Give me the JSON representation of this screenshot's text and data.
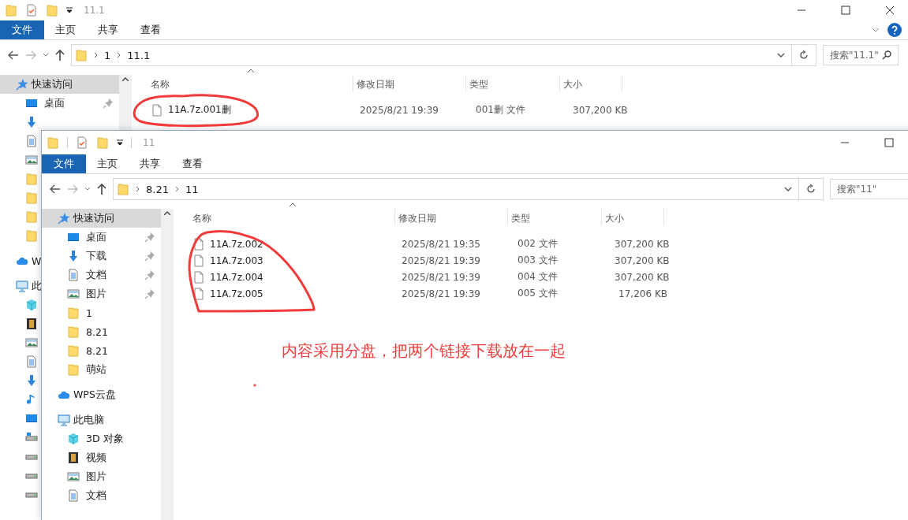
{
  "back_window": {
    "title": "11.1",
    "title_separators": false,
    "close_button": true,
    "help_button": true,
    "ribbon_tabs": [
      {
        "label": "文件",
        "kind": "file_menu"
      },
      {
        "label": "主页",
        "kind": "tab"
      },
      {
        "label": "共享",
        "kind": "tab"
      },
      {
        "label": "查看",
        "kind": "tab"
      }
    ],
    "path": [
      "1",
      "11.1"
    ],
    "search": {
      "placeholder": "搜索\"11.1\""
    },
    "sidebar": [
      {
        "label": "快速访问",
        "kind": "star",
        "selected": true,
        "children": [
          {
            "label": "桌面",
            "kind": "desktop",
            "pinned": true
          },
          {
            "kind": "download"
          },
          {
            "kind": "doc"
          },
          {
            "kind": "picture"
          },
          {
            "kind": "folder"
          },
          {
            "kind": "folder"
          },
          {
            "kind": "folder"
          },
          {
            "kind": "folder"
          }
        ]
      },
      {
        "label": "W",
        "kind": "cloud",
        "selected": false
      },
      {
        "label": "此",
        "kind": "pc",
        "selected": false,
        "children": [
          {
            "kind": "cube"
          },
          {
            "kind": "video"
          },
          {
            "kind": "picture"
          },
          {
            "kind": "doc"
          },
          {
            "kind": "download"
          },
          {
            "kind": "music"
          },
          {
            "kind": "desktop"
          },
          {
            "kind": "drive-win"
          },
          {
            "kind": "drive"
          },
          {
            "kind": "drive"
          },
          {
            "kind": "drive"
          }
        ]
      }
    ],
    "columns": [
      "名称",
      "修改日期",
      "类型",
      "大小"
    ],
    "files": [
      {
        "name": "11A.7z.001删",
        "modified": "2025/8/21 19:39",
        "type": "001删 文件",
        "size": "307,200 KB"
      }
    ]
  },
  "front_window": {
    "title": "11",
    "title_separators": true,
    "ribbon_tabs": [
      {
        "label": "文件",
        "kind": "file_menu"
      },
      {
        "label": "主页",
        "kind": "tab"
      },
      {
        "label": "共享",
        "kind": "tab"
      },
      {
        "label": "查看",
        "kind": "tab"
      }
    ],
    "path": [
      "8.21",
      "11"
    ],
    "search": {
      "placeholder": "搜索\"11\""
    },
    "sidebar": [
      {
        "label": "快速访问",
        "kind": "star",
        "selected": true,
        "children": [
          {
            "label": "桌面",
            "kind": "desktop",
            "pinned": true
          },
          {
            "label": "下载",
            "kind": "download",
            "pinned": true
          },
          {
            "label": "文档",
            "kind": "doc",
            "pinned": true
          },
          {
            "label": "图片",
            "kind": "picture",
            "pinned": true
          },
          {
            "label": "1",
            "kind": "folder",
            "pinned": false
          },
          {
            "label": "8.21",
            "kind": "folder",
            "pinned": false
          },
          {
            "label": "8.21",
            "kind": "folder",
            "pinned": false
          },
          {
            "label": "萌站",
            "kind": "folder",
            "pinned": false
          }
        ]
      },
      {
        "label": "WPS云盘",
        "kind": "cloud",
        "selected": false
      },
      {
        "label": "此电脑",
        "kind": "pc",
        "selected": false,
        "children": [
          {
            "label": "3D 对象",
            "kind": "cube"
          },
          {
            "label": "视频",
            "kind": "video"
          },
          {
            "label": "图片",
            "kind": "picture"
          },
          {
            "label": "文档",
            "kind": "doc"
          }
        ]
      }
    ],
    "columns": [
      "名称",
      "修改日期",
      "类型",
      "大小"
    ],
    "files": [
      {
        "name": "11A.7z.002",
        "modified": "2025/8/21 19:35",
        "type": "002 文件",
        "size": "307,200 KB"
      },
      {
        "name": "11A.7z.003",
        "modified": "2025/8/21 19:39",
        "type": "003 文件",
        "size": "307,200 KB"
      },
      {
        "name": "11A.7z.004",
        "modified": "2025/8/21 19:39",
        "type": "004 文件",
        "size": "307,200 KB"
      },
      {
        "name": "11A.7z.005",
        "modified": "2025/8/21 19:39",
        "type": "005 文件",
        "size": "17,206 KB"
      }
    ]
  },
  "annotation": {
    "text": "内容采用分盘，把两个链接下载放在一起"
  }
}
